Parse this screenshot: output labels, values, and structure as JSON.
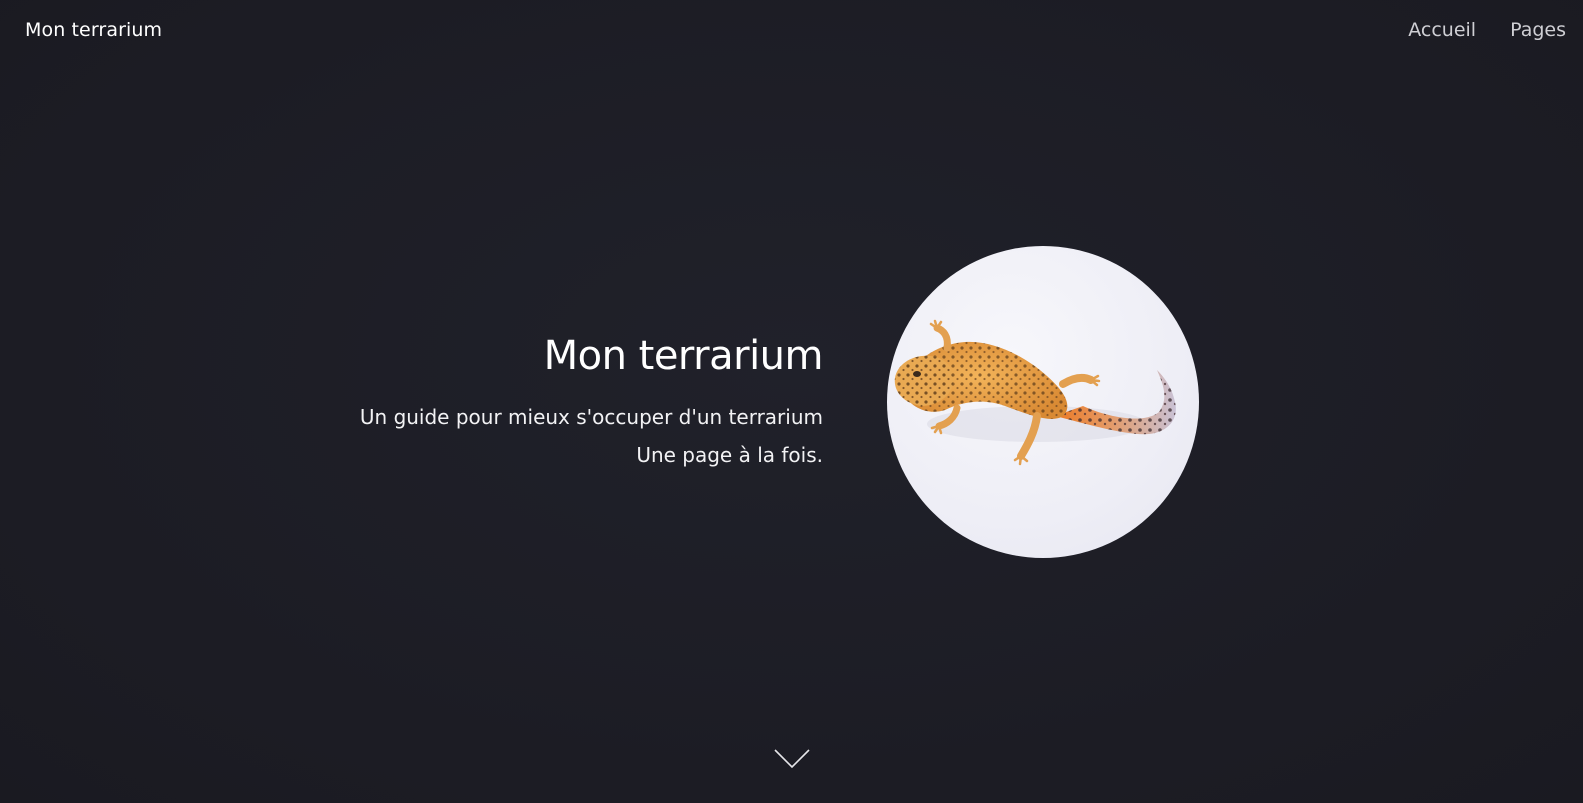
{
  "navbar": {
    "brand": "Mon terrarium",
    "links": [
      {
        "label": "Accueil"
      },
      {
        "label": "Pages"
      }
    ]
  },
  "hero": {
    "title": "Mon terrarium",
    "lines": [
      "Un guide pour mieux s'occuper d'un terrarium",
      "Une page à la fois."
    ],
    "image_icon": "leopard-gecko-photo"
  },
  "scroll_icon": "chevron-down-icon",
  "colors": {
    "background": "#1e1e26",
    "text": "#ffffff",
    "nav_link": "#cfcfd4",
    "image_bg": "#eeeef6",
    "gecko_body": "#e8a24a",
    "gecko_tail": "#e8842e"
  }
}
